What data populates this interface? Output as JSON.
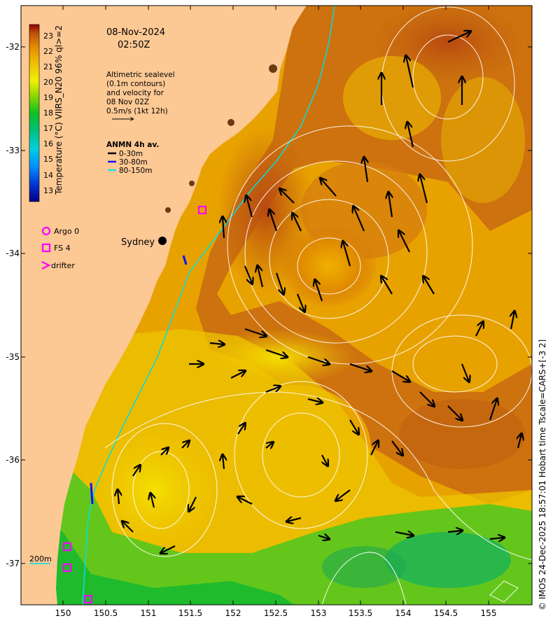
{
  "map": {
    "date": "08-Nov-2024",
    "time": "02:50Z",
    "altimetry_note": [
      "Altimetric sealevel",
      "(0.1m contours)",
      "and velocity for",
      "08 Nov 02Z",
      "0.5m/s (1kt 12h)"
    ],
    "anmn_title": "ANMN 4h av.",
    "anmn_depths": [
      {
        "label": "0-30m",
        "color": "#000000"
      },
      {
        "label": "30-80m",
        "color": "#1010ff"
      },
      {
        "label": "80-150m",
        "color": "#20e0e0"
      }
    ],
    "colorbar": {
      "title": "Temperature (°C) VIIRS_N20 96% ql>=2",
      "ticks": [
        "13",
        "14",
        "15",
        "16",
        "17",
        "18",
        "19",
        "20",
        "21",
        "22",
        "23"
      ],
      "colors": [
        "#000080",
        "#0030d0",
        "#0090ff",
        "#00d0e0",
        "#00c080",
        "#10c020",
        "#90d800",
        "#f0f000",
        "#f0c000",
        "#e08800",
        "#c05010",
        "#900000"
      ]
    },
    "legend": {
      "argo": "Argo 0",
      "fs": "FS 4",
      "drifter": "drifter",
      "marker_color": "#ff00ff"
    },
    "place": "Sydney",
    "isobath_label": "200m",
    "credit": "© IMOS 24-Dec-2025 18:57:01 Hobart time Tscale=CARS+[-3 2]",
    "x_ticks": [
      "150",
      "150.5",
      "151",
      "151.5",
      "152",
      "152.5",
      "153",
      "153.5",
      "154",
      "154.5",
      "155"
    ],
    "y_ticks": [
      "-32",
      "-33",
      "-34",
      "-35",
      "-36",
      "-37"
    ],
    "colors": {
      "land": "#fcc894",
      "ocean_warm": "#f0b000",
      "ocean_hot": "#d07010",
      "ocean_cool": "#e8e010",
      "ocean_green": "#30c030",
      "contour": "#ffffff",
      "shelf_line": "#00e0e0"
    }
  }
}
